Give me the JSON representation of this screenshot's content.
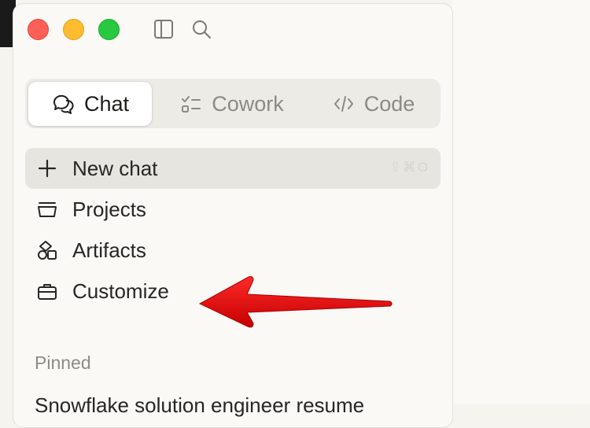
{
  "window": {
    "controls": [
      "close",
      "minimize",
      "maximize"
    ]
  },
  "toolbar": {
    "icons": [
      "sidebar-toggle-icon",
      "search-icon"
    ]
  },
  "mode_tabs": [
    {
      "label": "Chat",
      "icon": "chat-bubbles-icon",
      "active": true
    },
    {
      "label": "Cowork",
      "icon": "checklist-icon",
      "active": false
    },
    {
      "label": "Code",
      "icon": "code-brackets-icon",
      "active": false
    }
  ],
  "nav": {
    "new_chat": "New chat",
    "projects": "Projects",
    "artifacts": "Artifacts",
    "customize": "Customize"
  },
  "pinned": {
    "title": "Pinned",
    "items": [
      "Snowflake solution engineer resume"
    ]
  },
  "annotation": {
    "type": "arrow",
    "color": "#e30613",
    "points_to": "Customize"
  }
}
